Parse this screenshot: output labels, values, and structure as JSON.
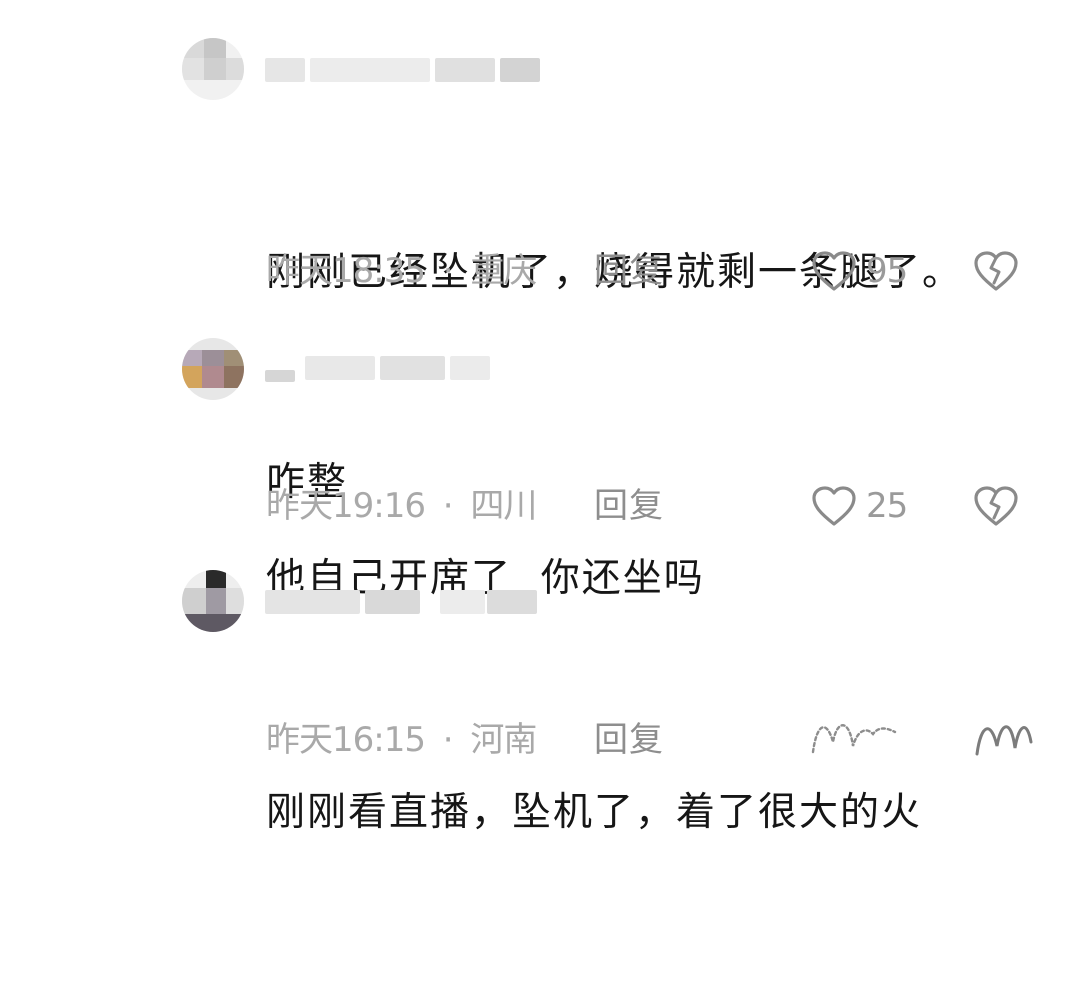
{
  "comments": [
    {
      "text_line1": "刚刚已经坠机了，烧得就剩一条腿了。",
      "text_line2": "咋整",
      "time": "昨天18:35",
      "location": "重庆",
      "reply_label": "回复",
      "likes": "95"
    },
    {
      "text_line1": "他自己开席了  你还坐吗",
      "time": "昨天19:16",
      "location": "四川",
      "reply_label": "回复",
      "likes": "25"
    },
    {
      "text_line1": "刚刚看直播，坠机了，着了很大的火",
      "time": "昨天16:15",
      "location": "河南",
      "reply_label": "回复"
    }
  ],
  "meta_separator": "·",
  "icons": {
    "like": "heart-outline-icon",
    "dislike": "broken-heart-icon"
  },
  "colors": {
    "text": "#161616",
    "meta": "#a9a9a9",
    "reply": "#8e8e8e",
    "icon": "#8a8a8a"
  }
}
